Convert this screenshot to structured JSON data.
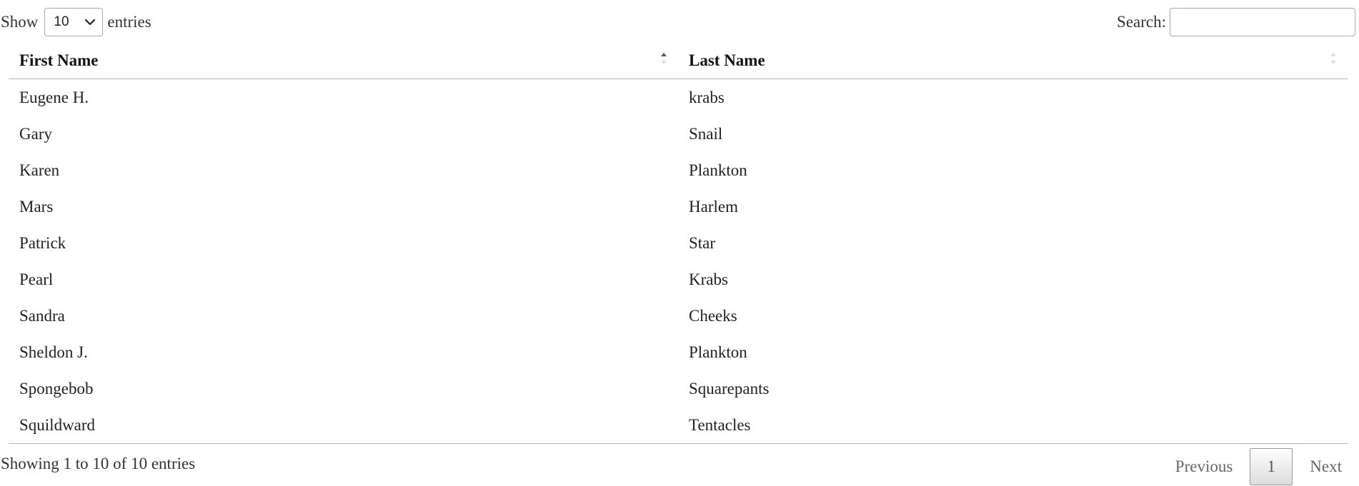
{
  "length": {
    "label_before": "Show",
    "selected": "10",
    "label_after": "entries"
  },
  "search": {
    "label": "Search:",
    "value": ""
  },
  "table": {
    "headers": [
      "First Name",
      "Last Name"
    ],
    "sort": {
      "column": "First Name",
      "direction": "ascending"
    },
    "rows": [
      [
        "Eugene H.",
        "krabs"
      ],
      [
        "Gary",
        "Snail"
      ],
      [
        "Karen",
        "Plankton"
      ],
      [
        "Mars",
        "Harlem"
      ],
      [
        "Patrick",
        "Star"
      ],
      [
        "Pearl",
        "Krabs"
      ],
      [
        "Sandra",
        "Cheeks"
      ],
      [
        "Sheldon J.",
        "Plankton"
      ],
      [
        "Spongebob",
        "Squarepants"
      ],
      [
        "Squildward",
        "Tentacles"
      ]
    ]
  },
  "footer": {
    "info": "Showing 1 to 10 of 10 entries",
    "previous": "Previous",
    "current_page": "1",
    "next": "Next"
  },
  "icons": {
    "length_dropdown": "chevron-down-icon",
    "sort": "sort-arrows-icon"
  },
  "colors": {
    "border": "#b5b5b5",
    "text": "#222222",
    "pager_text": "#666666"
  }
}
